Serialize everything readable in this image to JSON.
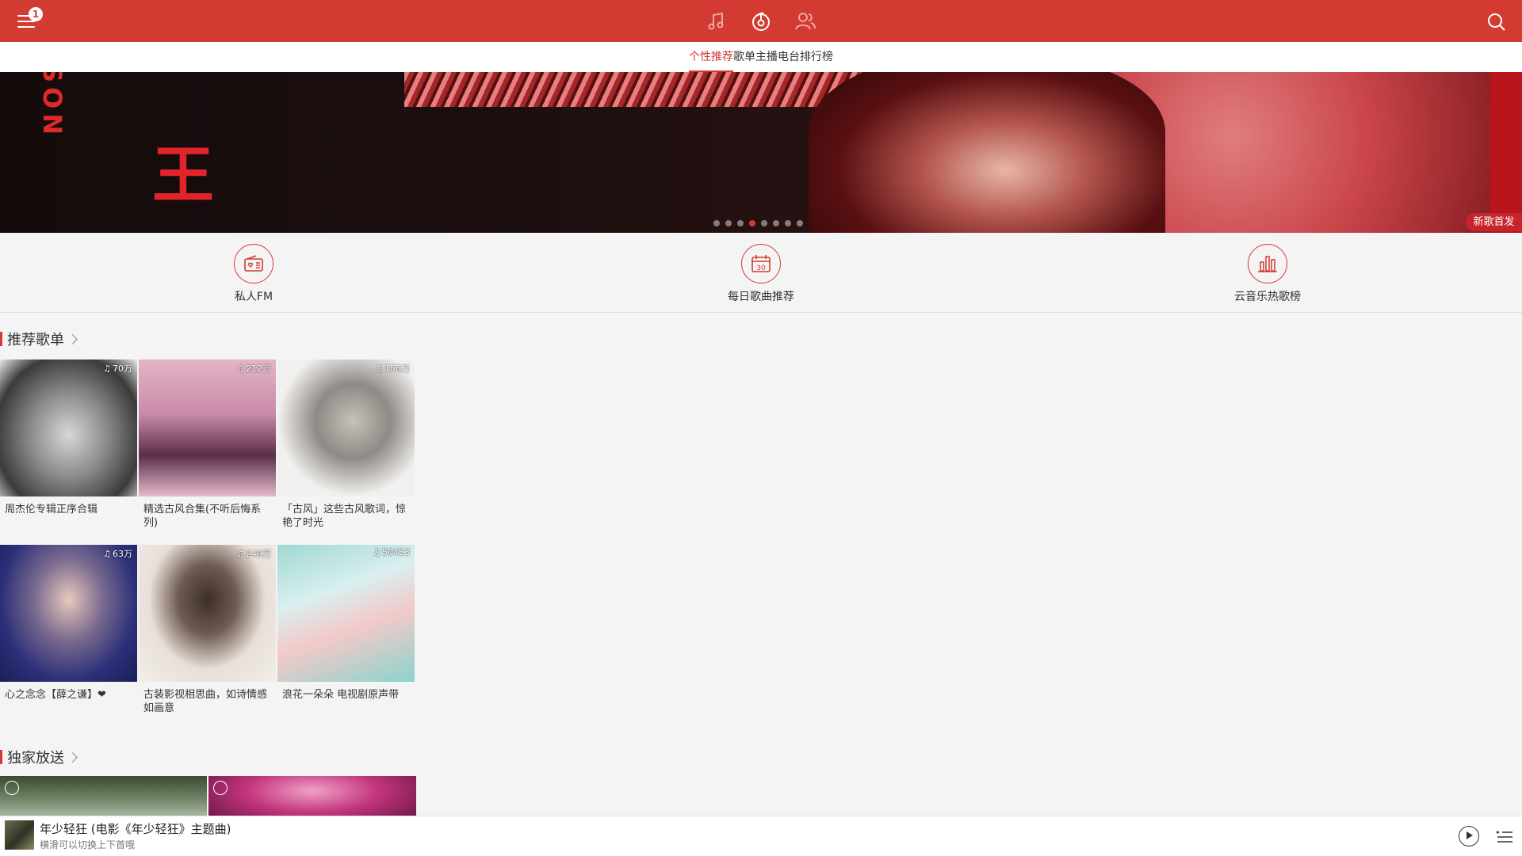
{
  "header": {
    "notification_count": "1",
    "icons": [
      "menu-icon",
      "music-note-icon",
      "radio-disc-icon",
      "friends-icon",
      "search-icon"
    ]
  },
  "tabs": [
    {
      "label": "个性推荐",
      "active": true
    },
    {
      "label": "歌单",
      "active": false
    },
    {
      "label": "主播电台",
      "active": false
    },
    {
      "label": "排行榜",
      "active": false
    }
  ],
  "banner": {
    "vertical_text": "SON",
    "big_char": "王",
    "tag": "新歌首发",
    "dot_count": 8,
    "active_dot": 3
  },
  "quick_entries": [
    {
      "label": "私人FM",
      "icon": "radio-icon"
    },
    {
      "label": "每日歌曲推荐",
      "icon": "calendar-icon",
      "day": "30"
    },
    {
      "label": "云音乐热歌榜",
      "icon": "bar-chart-icon"
    }
  ],
  "sections": {
    "recommended": {
      "title": "推荐歌单"
    },
    "exclusive": {
      "title": "独家放送"
    }
  },
  "playlists": [
    {
      "title": "周杰伦专辑正序合辑",
      "plays": "70万"
    },
    {
      "title": "精选古风合集(不听后悔系列)",
      "plays": "212万"
    },
    {
      "title": "「古风」这些古风歌词，惊艳了时光",
      "plays": "158万"
    },
    {
      "title": "心之念念【薛之谦】❤",
      "plays": "63万"
    },
    {
      "title": "古装影视相思曲，如诗情感如画意",
      "plays": "249万"
    },
    {
      "title": "浪花一朵朵 电视剧原声带",
      "plays": "50453"
    }
  ],
  "player": {
    "title": "年少轻狂 (电影《年少轻狂》主题曲)",
    "subtitle": "横滑可以切换上下首哦"
  },
  "colors": {
    "accent": "#d33a32",
    "background": "#f4f4f5"
  }
}
